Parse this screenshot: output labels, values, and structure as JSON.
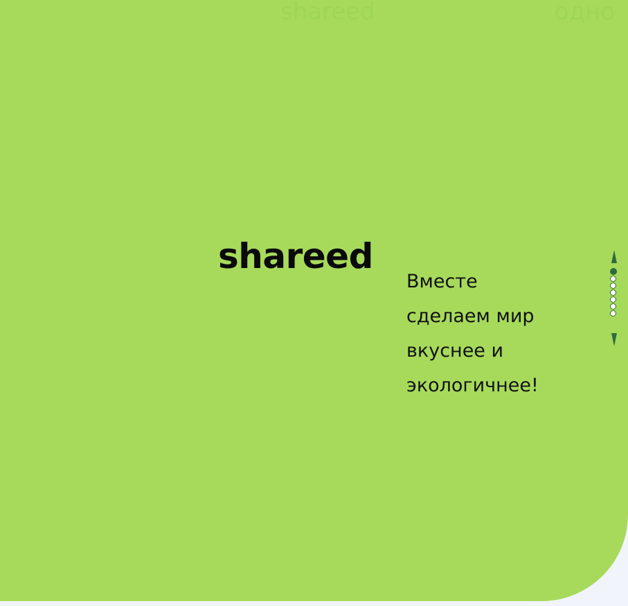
{
  "background_words": [
    "shareed",
    "одно"
  ],
  "brand": {
    "name": "shareed"
  },
  "tagline": {
    "lines": [
      "Вместе",
      "сделаем мир",
      "вкуснее и",
      "экологичнее!"
    ]
  },
  "pager": {
    "current_slide": 1,
    "total_slides": 7,
    "up_icon": "triangle-up-icon",
    "down_icon": "triangle-down-icon"
  },
  "colors": {
    "hero_background": "#a7da5b",
    "page_background": "#f1f4fb",
    "pager_accent": "#2f6b3d",
    "text": "#0a0a0a"
  }
}
